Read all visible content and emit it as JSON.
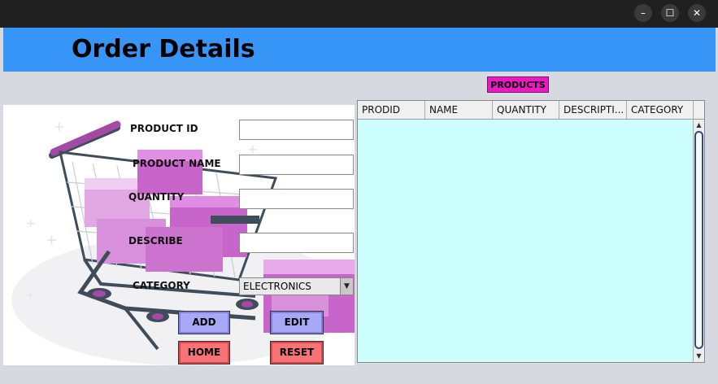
{
  "window": {
    "controls": {
      "minimize": "–",
      "maximize": "☐",
      "close": "✕"
    }
  },
  "header": {
    "title": "Order Details"
  },
  "products_label": "PRODUCTS",
  "form": {
    "product_id_label": "PRODUCT ID",
    "product_name_label": "PRODUCT NAME",
    "quantity_label": "QUANTITY",
    "describe_label": "DESCRIBE",
    "category_label": "CATEGORY",
    "product_id_value": "",
    "product_name_value": "",
    "quantity_value": "",
    "describe_value": "",
    "category_selected": "ELECTRONICS"
  },
  "buttons": {
    "add": "ADD",
    "edit": "EDIT",
    "home": "HOME",
    "reset": "RESET"
  },
  "table": {
    "columns": [
      "PRODID",
      "NAME",
      "QUANTITY",
      "DESCRIPTI...",
      "CATEGORY"
    ],
    "rows": []
  },
  "colors": {
    "header": "#3895f8",
    "products_label": "#ee19c4",
    "table_background": "#ccfefe",
    "blue_buttons": "#a8a8f8",
    "red_buttons": "#f77476"
  },
  "icons": {
    "illustration": "shopping-cart-with-boxes",
    "combo_arrow": "chevron-down-icon"
  }
}
